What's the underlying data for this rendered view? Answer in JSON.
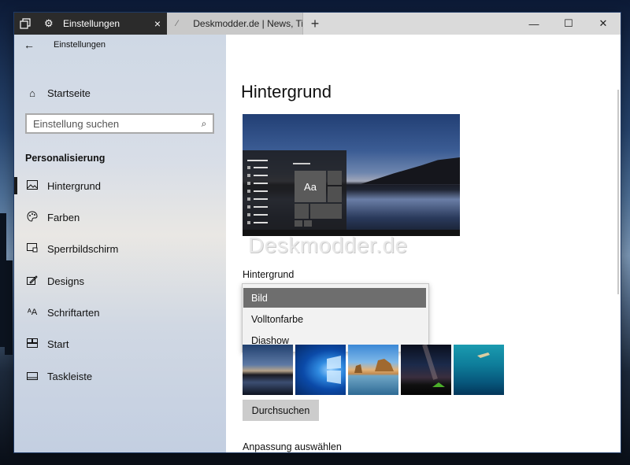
{
  "titlebar": {
    "active_tab": {
      "label": "Einstellungen",
      "icon": "gear-icon"
    },
    "inactive_tab": {
      "label": "Deskmodder.de | News, Tip",
      "icon": "page-icon"
    },
    "new_tab_symbol": "+",
    "controls": {
      "minimize": "—",
      "maximize": "☐",
      "close": "✕"
    }
  },
  "sidebar": {
    "back_symbol": "←",
    "title": "Einstellungen",
    "home": {
      "label": "Startseite",
      "icon": "home-icon",
      "symbol": "⌂"
    },
    "search": {
      "placeholder": "Einstellung suchen",
      "symbol": "⌕"
    },
    "section": "Personalisierung",
    "items": [
      {
        "label": "Hintergrund",
        "icon": "picture-icon",
        "symbol": "▭",
        "selected": true
      },
      {
        "label": "Farben",
        "icon": "palette-icon",
        "symbol": "☁",
        "selected": false
      },
      {
        "label": "Sperrbildschirm",
        "icon": "lockscreen-icon",
        "symbol": "▭",
        "selected": false
      },
      {
        "label": "Designs",
        "icon": "brush-icon",
        "symbol": "✎",
        "selected": false
      },
      {
        "label": "Schriftarten",
        "icon": "font-icon",
        "symbol": "ᴬA",
        "selected": false
      },
      {
        "label": "Start",
        "icon": "start-icon",
        "symbol": "▦",
        "selected": false
      },
      {
        "label": "Taskleiste",
        "icon": "taskbar-icon",
        "symbol": "▭",
        "selected": false
      }
    ]
  },
  "main": {
    "title": "Hintergrund",
    "preview_tile": "Aa",
    "watermark": "Deskmodder.de",
    "background_label": "Hintergrund",
    "dropdown_options": [
      "Bild",
      "Volltonfarbe",
      "Diashow"
    ],
    "selected_option": "Bild",
    "browse_button": "Durchsuchen",
    "fit_label": "Anpassung auswählen"
  },
  "colors": {
    "accent_dark": "#2b2b2b",
    "selected_item": "#6e6e6e",
    "button_bg": "#cccccc"
  }
}
